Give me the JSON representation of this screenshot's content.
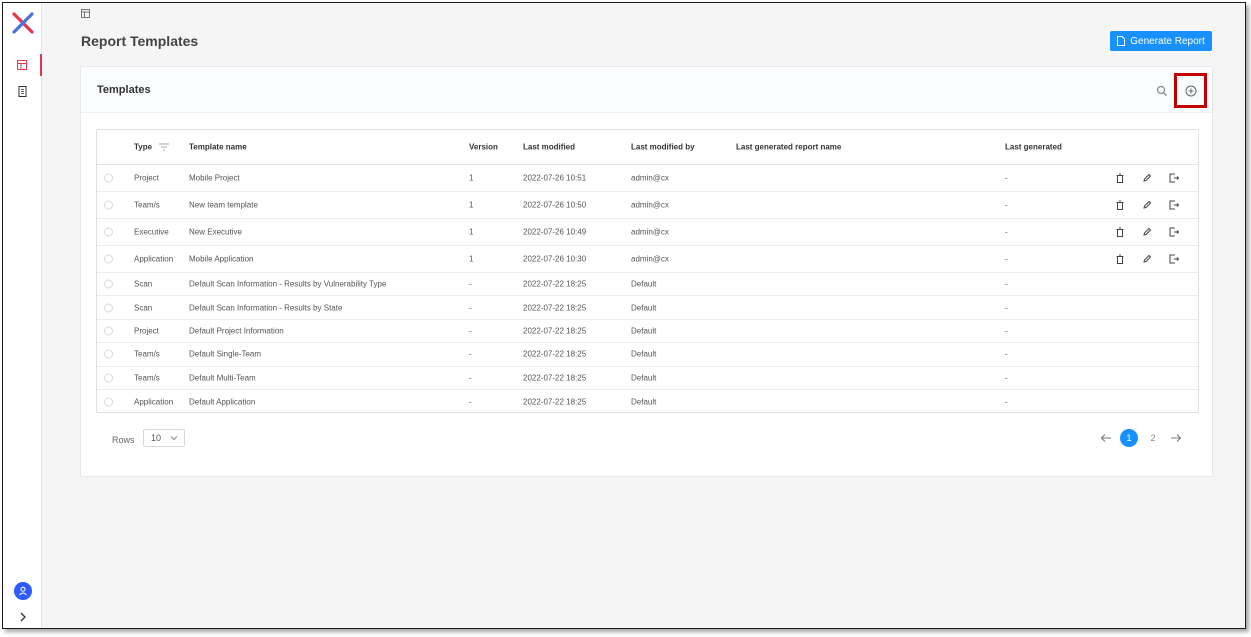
{
  "page": {
    "title": "Report Templates",
    "generate_button_label": "Generate Report"
  },
  "card": {
    "title": "Templates"
  },
  "table": {
    "headers": {
      "type": "Type",
      "name": "Template name",
      "version": "Version",
      "last_modified": "Last modified",
      "last_modified_by": "Last modified by",
      "last_report_name": "Last generated report name",
      "last_generated": "Last generated"
    },
    "rows": [
      {
        "type": "Project",
        "name": "Mobile Project",
        "version": "1",
        "modified": "2022-07-26 10:51",
        "by": "admin@cx",
        "report": "",
        "generated": "-",
        "actions": true
      },
      {
        "type": "Team/s",
        "name": "New team template",
        "version": "1",
        "modified": "2022-07-26 10:50",
        "by": "admin@cx",
        "report": "",
        "generated": "-",
        "actions": true
      },
      {
        "type": "Executive",
        "name": "New Executive",
        "version": "1",
        "modified": "2022-07-26 10:49",
        "by": "admin@cx",
        "report": "",
        "generated": "-",
        "actions": true
      },
      {
        "type": "Application",
        "name": "Mobile Application",
        "version": "1",
        "modified": "2022-07-26 10:30",
        "by": "admin@cx",
        "report": "",
        "generated": "-",
        "actions": true
      },
      {
        "type": "Scan",
        "name": "Default Scan Information - Results by Vulnerability Type",
        "version": "-",
        "modified": "2022-07-22 18:25",
        "by": "Default",
        "report": "",
        "generated": "-",
        "actions": false
      },
      {
        "type": "Scan",
        "name": "Default Scan Information - Results by State",
        "version": "-",
        "modified": "2022-07-22 18:25",
        "by": "Default",
        "report": "",
        "generated": "-",
        "actions": false
      },
      {
        "type": "Project",
        "name": "Default Project Information",
        "version": "-",
        "modified": "2022-07-22 18:25",
        "by": "Default",
        "report": "",
        "generated": "-",
        "actions": false
      },
      {
        "type": "Team/s",
        "name": "Default Single-Team",
        "version": "-",
        "modified": "2022-07-22 18:25",
        "by": "Default",
        "report": "",
        "generated": "-",
        "actions": false
      },
      {
        "type": "Team/s",
        "name": "Default Multi-Team",
        "version": "-",
        "modified": "2022-07-22 18:25",
        "by": "Default",
        "report": "",
        "generated": "-",
        "actions": false
      },
      {
        "type": "Application",
        "name": "Default Application",
        "version": "-",
        "modified": "2022-07-22 18:25",
        "by": "Default",
        "report": "",
        "generated": "-",
        "actions": false
      }
    ]
  },
  "pagination": {
    "rows_label": "Rows",
    "rows_value": "10",
    "pages": [
      "1",
      "2"
    ],
    "current_page": "1"
  },
  "colors": {
    "accent": "#1890ff",
    "active_nav": "#e0384f",
    "highlight": "#c00000"
  },
  "icons": {
    "logo": "checkmarx-logo",
    "nav_reports": "report-layout-icon",
    "nav_documents": "document-icon",
    "search": "search-icon",
    "add": "plus-circle-icon",
    "delete": "trash-icon",
    "edit": "pencil-icon",
    "export": "export-icon"
  }
}
